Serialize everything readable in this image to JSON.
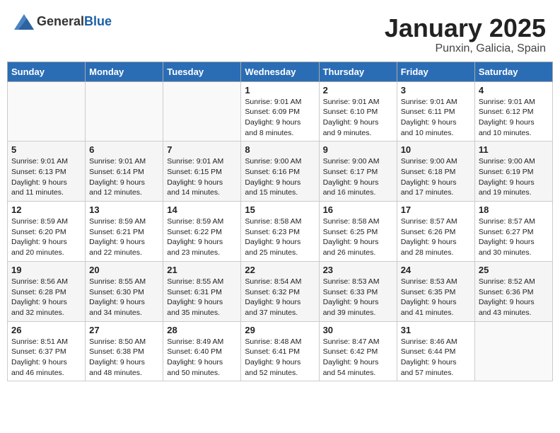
{
  "header": {
    "logo_general": "General",
    "logo_blue": "Blue",
    "month": "January 2025",
    "location": "Punxin, Galicia, Spain"
  },
  "weekdays": [
    "Sunday",
    "Monday",
    "Tuesday",
    "Wednesday",
    "Thursday",
    "Friday",
    "Saturday"
  ],
  "weeks": [
    [
      {
        "day": "",
        "content": ""
      },
      {
        "day": "",
        "content": ""
      },
      {
        "day": "",
        "content": ""
      },
      {
        "day": "1",
        "content": "Sunrise: 9:01 AM\nSunset: 6:09 PM\nDaylight: 9 hours and 8 minutes."
      },
      {
        "day": "2",
        "content": "Sunrise: 9:01 AM\nSunset: 6:10 PM\nDaylight: 9 hours and 9 minutes."
      },
      {
        "day": "3",
        "content": "Sunrise: 9:01 AM\nSunset: 6:11 PM\nDaylight: 9 hours and 10 minutes."
      },
      {
        "day": "4",
        "content": "Sunrise: 9:01 AM\nSunset: 6:12 PM\nDaylight: 9 hours and 10 minutes."
      }
    ],
    [
      {
        "day": "5",
        "content": "Sunrise: 9:01 AM\nSunset: 6:13 PM\nDaylight: 9 hours and 11 minutes."
      },
      {
        "day": "6",
        "content": "Sunrise: 9:01 AM\nSunset: 6:14 PM\nDaylight: 9 hours and 12 minutes."
      },
      {
        "day": "7",
        "content": "Sunrise: 9:01 AM\nSunset: 6:15 PM\nDaylight: 9 hours and 14 minutes."
      },
      {
        "day": "8",
        "content": "Sunrise: 9:00 AM\nSunset: 6:16 PM\nDaylight: 9 hours and 15 minutes."
      },
      {
        "day": "9",
        "content": "Sunrise: 9:00 AM\nSunset: 6:17 PM\nDaylight: 9 hours and 16 minutes."
      },
      {
        "day": "10",
        "content": "Sunrise: 9:00 AM\nSunset: 6:18 PM\nDaylight: 9 hours and 17 minutes."
      },
      {
        "day": "11",
        "content": "Sunrise: 9:00 AM\nSunset: 6:19 PM\nDaylight: 9 hours and 19 minutes."
      }
    ],
    [
      {
        "day": "12",
        "content": "Sunrise: 8:59 AM\nSunset: 6:20 PM\nDaylight: 9 hours and 20 minutes."
      },
      {
        "day": "13",
        "content": "Sunrise: 8:59 AM\nSunset: 6:21 PM\nDaylight: 9 hours and 22 minutes."
      },
      {
        "day": "14",
        "content": "Sunrise: 8:59 AM\nSunset: 6:22 PM\nDaylight: 9 hours and 23 minutes."
      },
      {
        "day": "15",
        "content": "Sunrise: 8:58 AM\nSunset: 6:23 PM\nDaylight: 9 hours and 25 minutes."
      },
      {
        "day": "16",
        "content": "Sunrise: 8:58 AM\nSunset: 6:25 PM\nDaylight: 9 hours and 26 minutes."
      },
      {
        "day": "17",
        "content": "Sunrise: 8:57 AM\nSunset: 6:26 PM\nDaylight: 9 hours and 28 minutes."
      },
      {
        "day": "18",
        "content": "Sunrise: 8:57 AM\nSunset: 6:27 PM\nDaylight: 9 hours and 30 minutes."
      }
    ],
    [
      {
        "day": "19",
        "content": "Sunrise: 8:56 AM\nSunset: 6:28 PM\nDaylight: 9 hours and 32 minutes."
      },
      {
        "day": "20",
        "content": "Sunrise: 8:55 AM\nSunset: 6:30 PM\nDaylight: 9 hours and 34 minutes."
      },
      {
        "day": "21",
        "content": "Sunrise: 8:55 AM\nSunset: 6:31 PM\nDaylight: 9 hours and 35 minutes."
      },
      {
        "day": "22",
        "content": "Sunrise: 8:54 AM\nSunset: 6:32 PM\nDaylight: 9 hours and 37 minutes."
      },
      {
        "day": "23",
        "content": "Sunrise: 8:53 AM\nSunset: 6:33 PM\nDaylight: 9 hours and 39 minutes."
      },
      {
        "day": "24",
        "content": "Sunrise: 8:53 AM\nSunset: 6:35 PM\nDaylight: 9 hours and 41 minutes."
      },
      {
        "day": "25",
        "content": "Sunrise: 8:52 AM\nSunset: 6:36 PM\nDaylight: 9 hours and 43 minutes."
      }
    ],
    [
      {
        "day": "26",
        "content": "Sunrise: 8:51 AM\nSunset: 6:37 PM\nDaylight: 9 hours and 46 minutes."
      },
      {
        "day": "27",
        "content": "Sunrise: 8:50 AM\nSunset: 6:38 PM\nDaylight: 9 hours and 48 minutes."
      },
      {
        "day": "28",
        "content": "Sunrise: 8:49 AM\nSunset: 6:40 PM\nDaylight: 9 hours and 50 minutes."
      },
      {
        "day": "29",
        "content": "Sunrise: 8:48 AM\nSunset: 6:41 PM\nDaylight: 9 hours and 52 minutes."
      },
      {
        "day": "30",
        "content": "Sunrise: 8:47 AM\nSunset: 6:42 PM\nDaylight: 9 hours and 54 minutes."
      },
      {
        "day": "31",
        "content": "Sunrise: 8:46 AM\nSunset: 6:44 PM\nDaylight: 9 hours and 57 minutes."
      },
      {
        "day": "",
        "content": ""
      }
    ]
  ]
}
